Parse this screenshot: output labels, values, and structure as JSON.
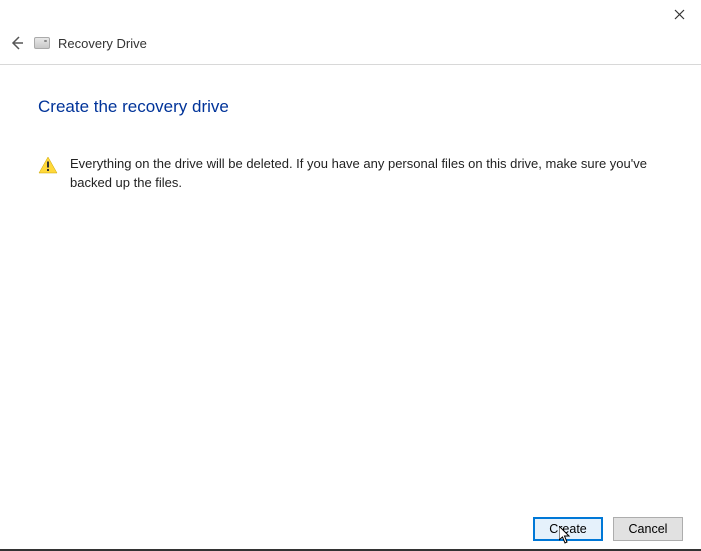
{
  "window": {
    "title": "Recovery Drive"
  },
  "content": {
    "heading": "Create the recovery drive",
    "warning_message": "Everything on the drive will be deleted. If you have any personal files on this drive, make sure you've backed up the files."
  },
  "footer": {
    "primary_label": "Create",
    "secondary_label": "Cancel"
  }
}
